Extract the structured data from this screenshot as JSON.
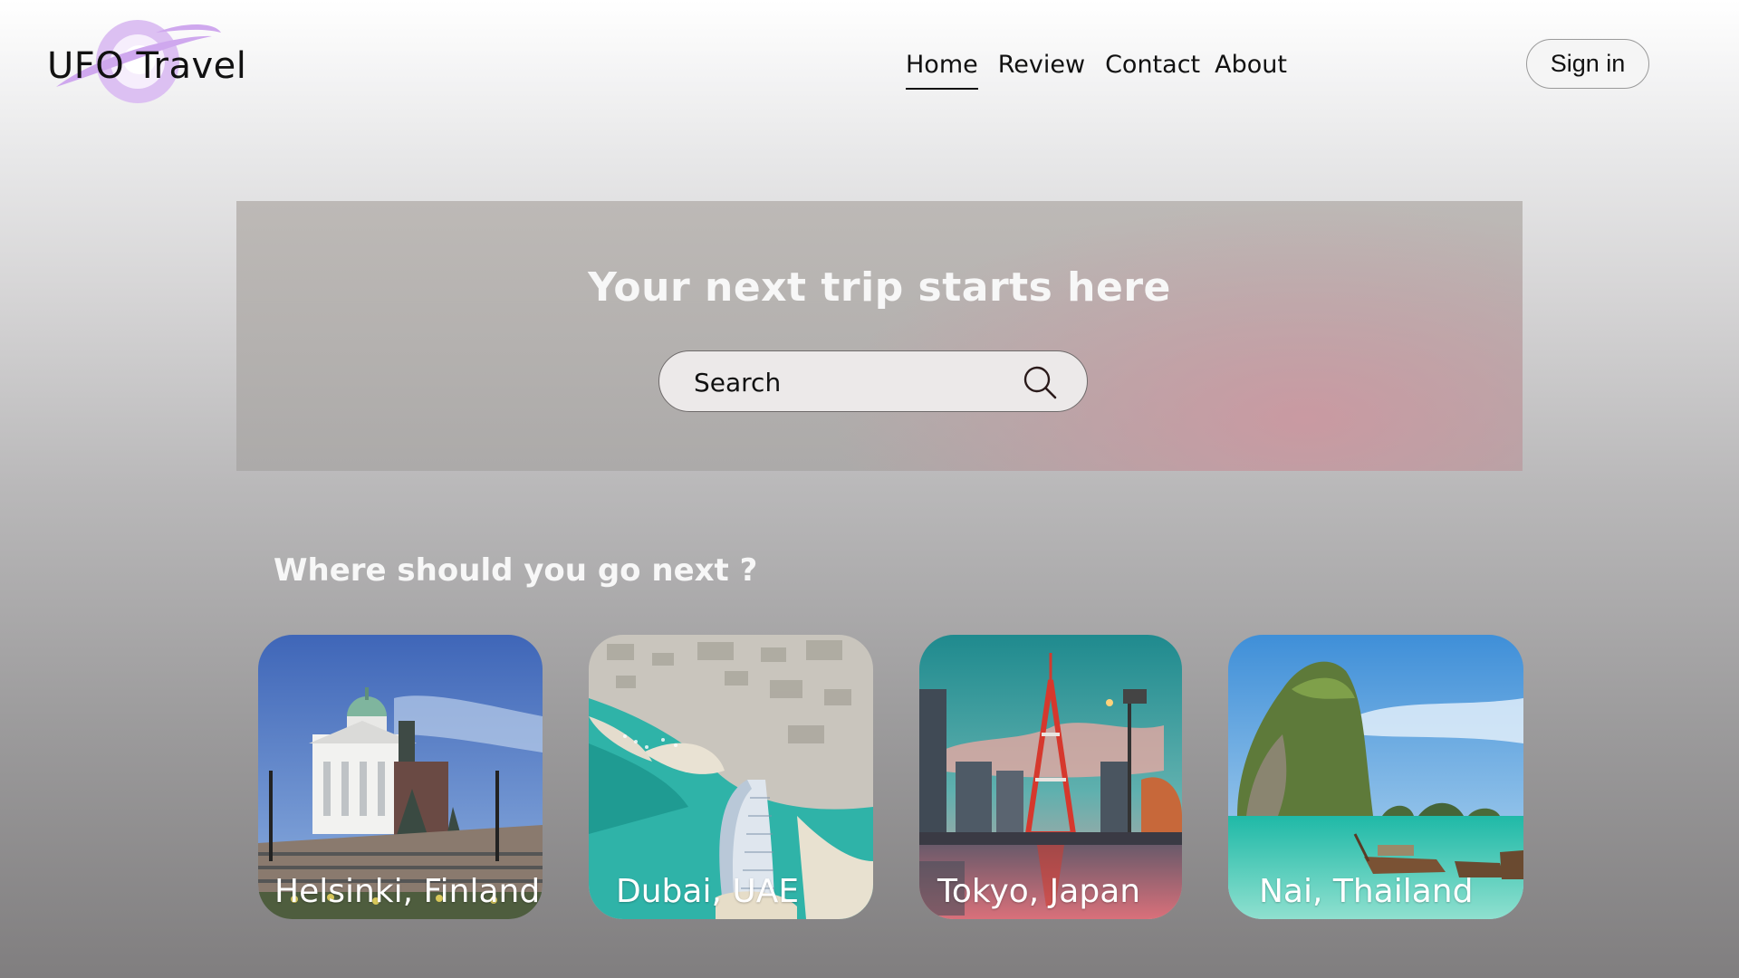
{
  "brand": {
    "name": "UFO Travel",
    "logo_color": "#d9b8f0"
  },
  "nav": {
    "items": [
      {
        "label": "Home",
        "active": true
      },
      {
        "label": "Review",
        "active": false
      },
      {
        "label": "Contact",
        "active": false
      },
      {
        "label": "About",
        "active": false
      }
    ]
  },
  "auth": {
    "signin_label": "Sign in"
  },
  "hero": {
    "title": "Your next trip starts here",
    "search": {
      "placeholder": "Search",
      "value": "",
      "icon": "search-icon"
    }
  },
  "destinations": {
    "title": "Where should you go next ?",
    "items": [
      {
        "label": "Helsinki, Finland",
        "image": "helsinki-cathedral-image"
      },
      {
        "label": "Dubai, UAE",
        "image": "dubai-burj-al-arab-image"
      },
      {
        "label": "Tokyo, Japan",
        "image": "tokyo-tower-image"
      },
      {
        "label": "Nai, Thailand",
        "image": "thailand-limestone-island-image"
      }
    ]
  }
}
